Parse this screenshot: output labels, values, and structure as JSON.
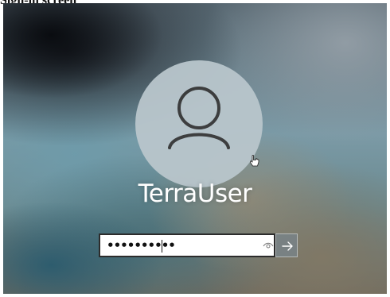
{
  "caption": {
    "text": "Sign-in screen"
  },
  "user": {
    "name": "TerraUser"
  },
  "password_field": {
    "value": "••••••••••",
    "show_password_icon": "eye-icon"
  },
  "submit": {
    "icon": "arrow-right-icon"
  },
  "colors": {
    "avatar_fill": "#b9c6cc",
    "avatar_glyph": "#3a3a3a",
    "username_text": "#ffffff",
    "input_border": "#2c2c2c",
    "submit_bg": "#78828a"
  }
}
